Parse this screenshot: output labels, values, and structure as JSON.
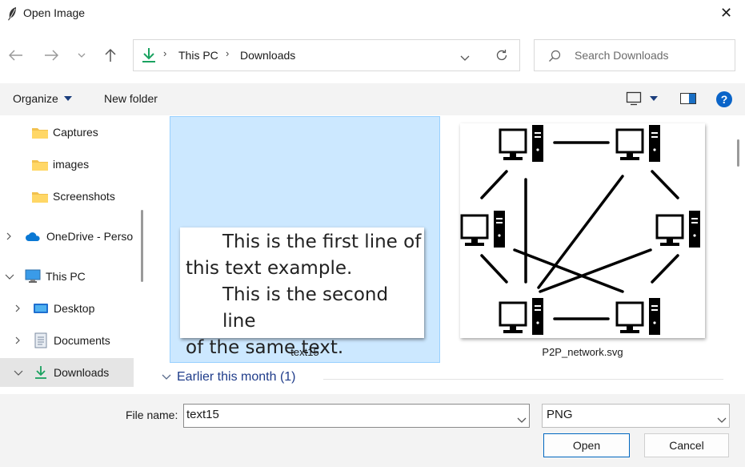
{
  "window": {
    "title": "Open Image",
    "close_symbol": "✕"
  },
  "nav": {
    "breadcrumb": [
      "This PC",
      "Downloads"
    ],
    "search_placeholder": "Search Downloads"
  },
  "toolbar": {
    "organize": "Organize",
    "new_folder": "New folder"
  },
  "sidebar": {
    "items": [
      {
        "label": "Captures"
      },
      {
        "label": "images"
      },
      {
        "label": "Screenshots"
      },
      {
        "label": "OneDrive - Perso"
      },
      {
        "label": "This PC"
      },
      {
        "label": "Desktop"
      },
      {
        "label": "Documents"
      },
      {
        "label": "Downloads"
      }
    ]
  },
  "files": {
    "items": [
      {
        "name": "text15",
        "selected": true,
        "preview_lines": [
          "This is the first line of",
          "this text example.",
          "This is the second line",
          "of the same text."
        ]
      },
      {
        "name": "P2P_network.svg",
        "selected": false
      }
    ],
    "group_header": "Earlier this month (1)"
  },
  "bottom": {
    "file_name_label": "File name:",
    "file_name_value": "text15",
    "file_type_value": "PNG",
    "open_label": "Open",
    "cancel_label": "Cancel"
  },
  "colors": {
    "accent": "#0067c0",
    "selection": "#cce8ff",
    "group_header": "#1f3c8a",
    "download_green": "#1aa260",
    "help_blue": "#0a64c8"
  }
}
